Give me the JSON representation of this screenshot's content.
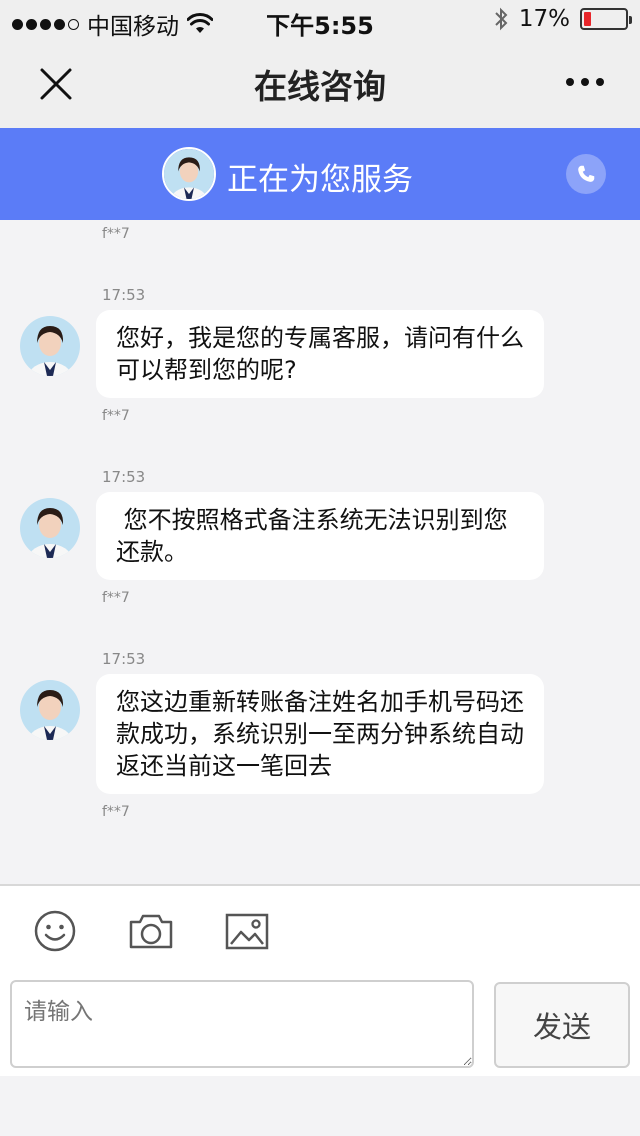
{
  "status_bar": {
    "carrier": "中国移动",
    "time": "下午5:55",
    "battery": "17%",
    "battery_level": 0.17
  },
  "nav": {
    "title": "在线咨询"
  },
  "banner": {
    "title": "正在为您服务"
  },
  "messages": [
    {
      "sender": "f**7"
    },
    {
      "time": "17:53",
      "text": "您好，我是您的专属客服，请问有什么可以帮到您的呢?",
      "sender": "f**7"
    },
    {
      "time": "17:53",
      "text": " 您不按照格式备注系统无法识别到您还款。",
      "sender": "f**7"
    },
    {
      "time": "17:53",
      "text": "您这边重新转账备注姓名加手机号码还款成功，系统识别一至两分钟系统自动返还当前这一笔回去",
      "sender": "f**7"
    }
  ],
  "composer": {
    "placeholder": "请输入",
    "send_label": "发送"
  },
  "colors": {
    "banner": "#5b7cf7",
    "battery_low": "#e8262b"
  }
}
